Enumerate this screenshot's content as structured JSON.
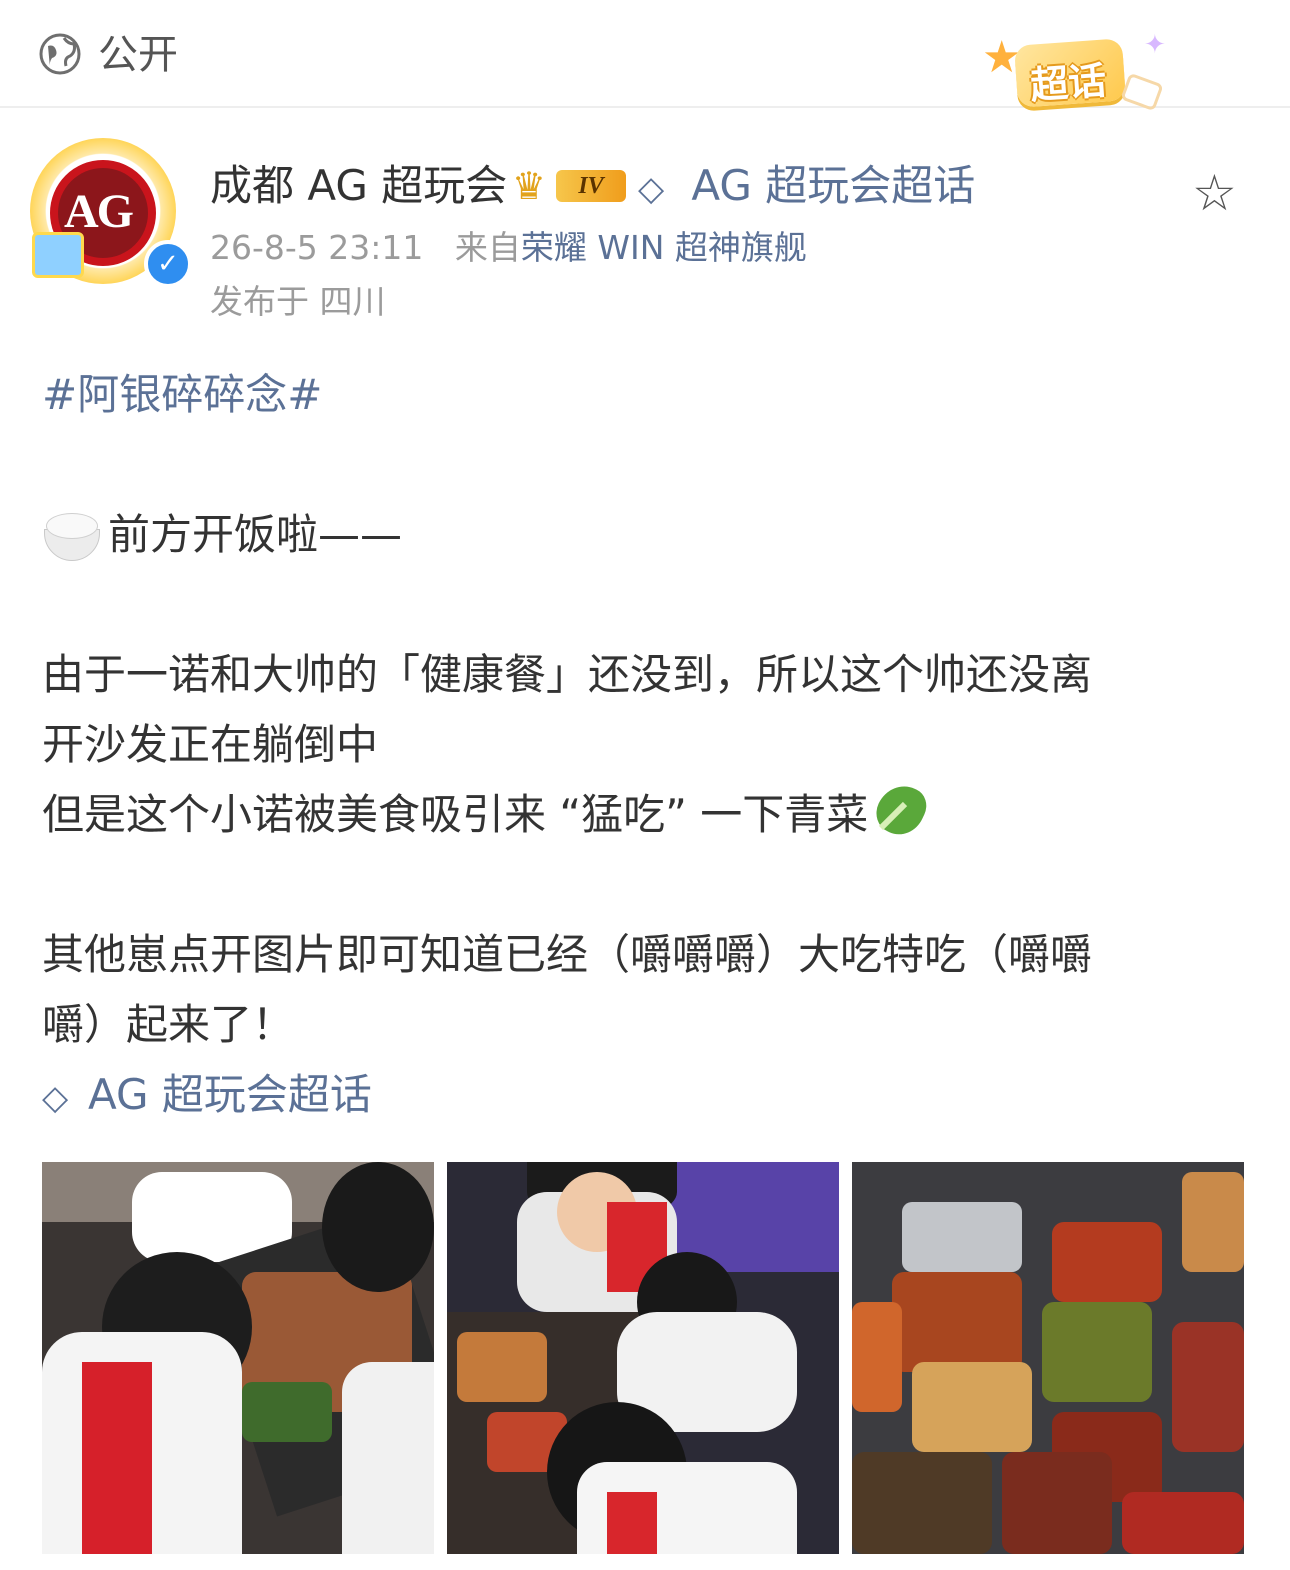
{
  "header": {
    "visibility_icon": "globe-icon",
    "visibility_label": "公开",
    "badge_label": "超话"
  },
  "author": {
    "avatar_text": "AG",
    "name": "成都 AG 超玩会",
    "level_badge": "IV",
    "verified_icon": "verified-icon",
    "topic_link": "AG 超玩会超话",
    "timestamp": "26-8-5 23:11",
    "source_prefix": "来自",
    "source": "荣耀 WIN 超神旗舰",
    "location": "发布于 四川"
  },
  "post": {
    "hashtag": "#阿银碎碎念#",
    "line_1": "前方开饭啦——",
    "para_2_line_1": "由于一诺和大帅的「健康餐」还没到，所以这个帅还没离",
    "para_2_line_2": "开沙发正在躺倒中",
    "para_2_line_3": "但是这个小诺被美食吸引来 “猛吃” 一下青菜",
    "para_3_line_1": "其他崽点开图片即可知道已经（嚼嚼嚼）大吃特吃（嚼嚼",
    "para_3_line_2": "嚼）起来了！",
    "topic_footer": "AG 超玩会超话"
  },
  "colors": {
    "link": "#5b7196",
    "meta": "#9b9b9b",
    "text": "#333333",
    "brand_red": "#c9141c"
  }
}
